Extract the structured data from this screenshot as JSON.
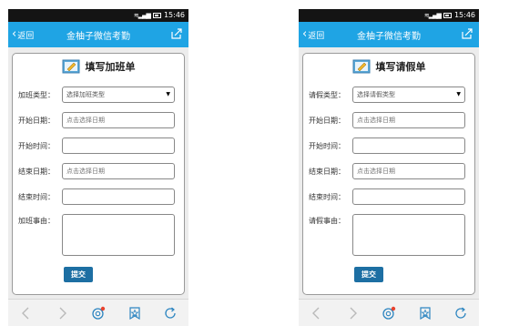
{
  "status_bar": {
    "time": "15:46"
  },
  "app_header": {
    "back_label": "返回",
    "title": "金柚子微信考勤"
  },
  "overtime_form": {
    "title": "填写加班单",
    "type_label": "加班类型：",
    "type_value": "选择加班类型",
    "start_date_label": "开始日期：",
    "start_date_placeholder": "点击选择日期",
    "start_time_label": "开始时间：",
    "end_date_label": "结束日期：",
    "end_date_placeholder": "点击选择日期",
    "end_time_label": "结束时间：",
    "reason_label": "加班事由：",
    "submit_label": "提交"
  },
  "leave_form": {
    "title": "填写请假单",
    "type_label": "请假类型：",
    "type_value": "选择请假类型",
    "start_date_label": "开始日期：",
    "start_date_placeholder": "点击选择日期",
    "start_time_label": "开始时间：",
    "end_date_label": "结束日期：",
    "end_date_placeholder": "点击选择日期",
    "end_time_label": "结束时间：",
    "reason_label": "请假事由：",
    "submit_label": "提交"
  },
  "bottom_nav": [
    "back-arrow-icon",
    "forward-arrow-icon",
    "search-globe-icon",
    "bookmark-star-icon",
    "refresh-icon"
  ],
  "colors": {
    "title_bar": "#1fa4e4",
    "status_bar": "#141414",
    "submit_button": "#1d6fa3",
    "notification_dot": "#e8432f"
  }
}
